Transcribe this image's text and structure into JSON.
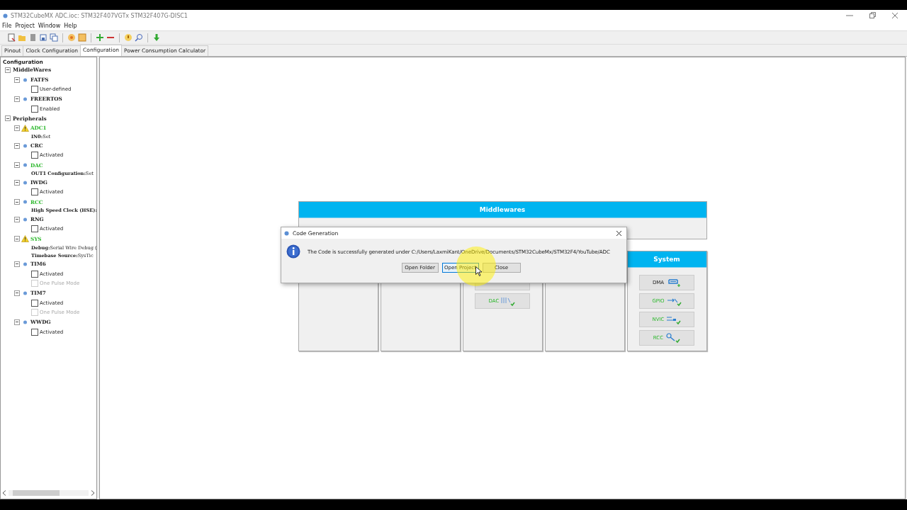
{
  "window": {
    "title": "STM32CubeMX ADC.ioc: STM32F407VGTx STM32F407G-DISC1"
  },
  "menu": [
    "File",
    "Project",
    "Window",
    "Help"
  ],
  "tabs": [
    {
      "label": "Pinout",
      "selected": false
    },
    {
      "label": "Clock Configuration",
      "selected": false
    },
    {
      "label": "Configuration",
      "selected": true
    },
    {
      "label": "Power Consumption Calculator",
      "selected": false
    }
  ],
  "tree": {
    "label": "Configuration",
    "children": [
      {
        "label": "MiddleWares",
        "expanded": true,
        "children": [
          {
            "label": "FATFS",
            "kind": "ok",
            "configured": false,
            "expanded": true,
            "children": [
              {
                "kind": "checkbox",
                "label": "User-defined",
                "checked": false,
                "disabled": false
              }
            ]
          },
          {
            "label": "FREERTOS",
            "kind": "ok",
            "configured": false,
            "expanded": true,
            "children": [
              {
                "kind": "checkbox",
                "label": "Enabled",
                "checked": false,
                "disabled": false
              }
            ]
          }
        ]
      },
      {
        "label": "Peripherals",
        "expanded": true,
        "children": [
          {
            "label": "ADC1",
            "kind": "warning",
            "configured": true,
            "expanded": true,
            "children": [
              {
                "kind": "setting",
                "label": "IN0:",
                "value": "Set"
              }
            ]
          },
          {
            "label": "CRC",
            "kind": "ok",
            "configured": false,
            "expanded": true,
            "children": [
              {
                "kind": "checkbox",
                "label": "Activated",
                "checked": false,
                "disabled": false
              }
            ]
          },
          {
            "label": "DAC",
            "kind": "ok",
            "configured": true,
            "expanded": true,
            "children": [
              {
                "kind": "setting",
                "label": "OUT1 Configuration:",
                "value": "Set"
              }
            ]
          },
          {
            "label": "IWDG",
            "kind": "ok",
            "configured": false,
            "expanded": true,
            "children": [
              {
                "kind": "checkbox",
                "label": "Activated",
                "checked": false,
                "disabled": false
              }
            ]
          },
          {
            "label": "RCC",
            "kind": "ok",
            "configured": true,
            "expanded": true,
            "children": [
              {
                "kind": "setting",
                "label": "High Speed Clock (HSE):"
              }
            ]
          },
          {
            "label": "RNG",
            "kind": "ok",
            "configured": false,
            "expanded": true,
            "children": [
              {
                "kind": "checkbox",
                "label": "Activated",
                "checked": false,
                "disabled": false
              }
            ]
          },
          {
            "label": "SYS",
            "kind": "warning",
            "configured": true,
            "expanded": true,
            "children": [
              {
                "kind": "setting",
                "label": "Debug:",
                "value": "Serial Wire Debug ("
              },
              {
                "kind": "setting",
                "label": "Timebase Source:",
                "value": "SysTic"
              }
            ]
          },
          {
            "label": "TIM6",
            "kind": "ok",
            "configured": false,
            "expanded": true,
            "children": [
              {
                "kind": "checkbox",
                "label": "Activated",
                "checked": false,
                "disabled": false
              },
              {
                "kind": "checkbox",
                "label": "One Pulse Mode",
                "checked": false,
                "disabled": true
              }
            ]
          },
          {
            "label": "TIM7",
            "kind": "ok",
            "configured": false,
            "expanded": true,
            "children": [
              {
                "kind": "checkbox",
                "label": "Activated",
                "checked": false,
                "disabled": false
              },
              {
                "kind": "checkbox",
                "label": "One Pulse Mode",
                "checked": false,
                "disabled": true
              }
            ]
          },
          {
            "label": "WWDG",
            "kind": "ok",
            "configured": false,
            "expanded": true,
            "children": [
              {
                "kind": "checkbox",
                "label": "Activated",
                "checked": false,
                "disabled": false
              }
            ]
          }
        ]
      }
    ]
  },
  "middlewares": {
    "title": "Middlewares"
  },
  "columns": [
    {},
    {},
    {
      "buttons": [
        {
          "kind": "covered"
        },
        {
          "kind": "peripheral",
          "label": "DAC",
          "configured": true
        }
      ]
    },
    {},
    {
      "title": "System",
      "buttons": [
        {
          "kind": "peripheral",
          "label": "DMA",
          "configured": false
        },
        {
          "kind": "peripheral",
          "label": "GPIO",
          "configured": true
        },
        {
          "kind": "peripheral",
          "label": "NVIC",
          "configured": true
        },
        {
          "kind": "peripheral",
          "label": "RCC",
          "configured": true
        }
      ]
    }
  ],
  "dialog": {
    "title": "Code Generation",
    "message": "The Code is successfully generated under C:/Users/LaxmiKant/OneDrive/Documents/STM32CubeMx/STM32F4/YouTube/ADC",
    "buttons": [
      {
        "label": "Open Folder",
        "focused": false
      },
      {
        "label": "Open Project",
        "focused": true
      },
      {
        "label": "Close",
        "focused": false
      }
    ]
  }
}
